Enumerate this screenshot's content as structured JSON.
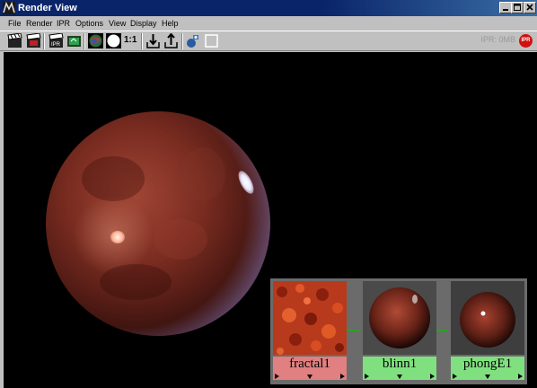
{
  "window": {
    "title": "Render View"
  },
  "menu": [
    "File",
    "Render",
    "IPR",
    "Options",
    "View",
    "Display",
    "Help"
  ],
  "toolbar": {
    "ratio_label": "1:1",
    "ipr_info": "IPR: 0MB",
    "ipr_badge": "IPR",
    "buttons": [
      "redo-render-icon",
      "render-region-icon",
      "ipr-render-icon",
      "refresh-ipr-icon",
      "rgb-channel-icon",
      "alpha-channel-icon",
      "keep-image-icon",
      "remove-image-icon",
      "snapshot-icon",
      "region-select-icon"
    ]
  },
  "hypershade": {
    "nodes": [
      {
        "label": "fractal1",
        "color": "#e08080"
      },
      {
        "label": "blinn1",
        "color": "#80e080"
      },
      {
        "label": "phongE1",
        "color": "#80e080"
      }
    ],
    "connection_color": "#2aa02a"
  }
}
